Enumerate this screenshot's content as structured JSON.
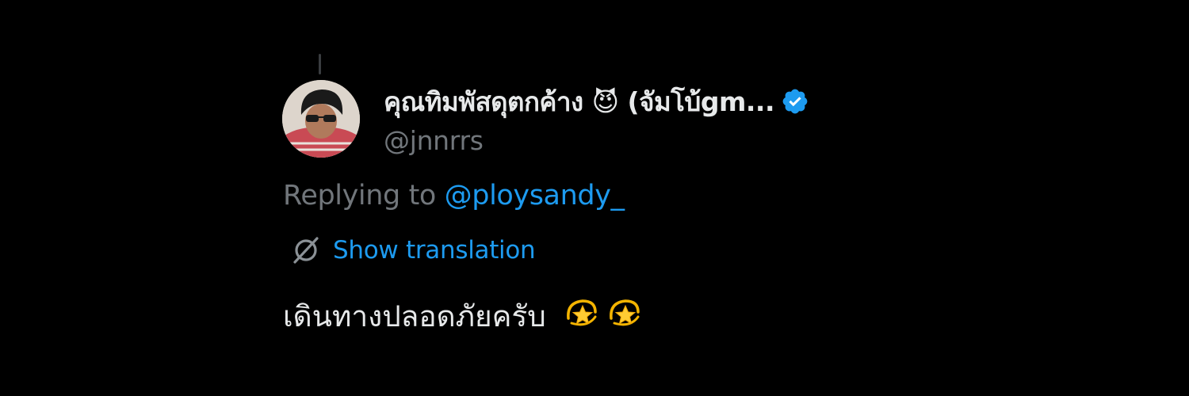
{
  "tweet": {
    "author": {
      "display_name": "คุณทิมพัสดุตกค้าง 😈 (จัมโบ้gm...",
      "handle": "@jnnrrs",
      "verified": true,
      "avatar_icon": "avatar-photo"
    },
    "reply_context": {
      "prefix": "Replying to ",
      "mention": "@ploysandy_"
    },
    "translation": {
      "label": "Show translation",
      "icon": "translate-icon"
    },
    "text": "เดินทางปลอดภัยครับ",
    "text_emojis": [
      "dizzy-star-emoji",
      "dizzy-star-emoji"
    ]
  },
  "colors": {
    "background": "#000000",
    "primary_text": "#e7e9ea",
    "secondary_text": "#71767b",
    "accent": "#1d9bf0"
  }
}
